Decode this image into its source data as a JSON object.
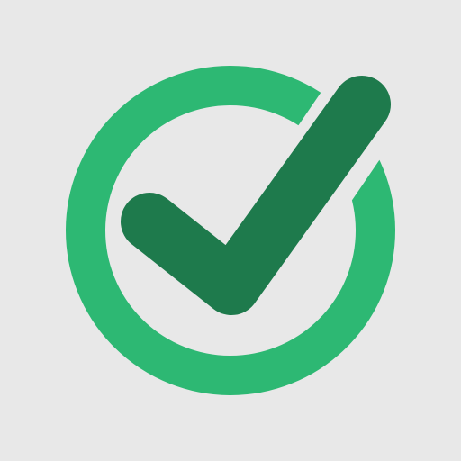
{
  "icon": {
    "name": "checkmark-circle-icon",
    "colors": {
      "background": "#e8e8e8",
      "ring": "#2db873",
      "check": "#1e7a4c"
    }
  }
}
